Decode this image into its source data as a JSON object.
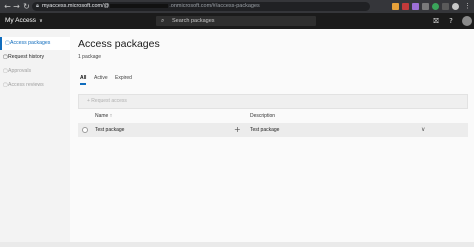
{
  "browser": {
    "back_icon": "←",
    "forward_icon": "→",
    "reload_icon": "↻",
    "url_host": "myaccess.microsoft.com",
    "url_mid": "/@",
    "url_path": ".onmicrosoft.com/#/access-packages"
  },
  "app": {
    "brand": "My Access",
    "brand_chevron": "∨",
    "search_placeholder": "Search packages",
    "search_icon": "⌕",
    "org_icon": "⛝",
    "help_icon": "?",
    "settings_icon": "⚙"
  },
  "sidebar": {
    "items": [
      {
        "label": "Access packages",
        "icon": "▢"
      },
      {
        "label": "Request history",
        "icon": "▢"
      },
      {
        "label": "Approvals",
        "icon": "▢"
      },
      {
        "label": "Access reviews",
        "icon": "▢"
      }
    ]
  },
  "main": {
    "title": "Access packages",
    "count": "1 package",
    "tabs": [
      "All",
      "Active",
      "Expired"
    ],
    "request_label": "+ Request access",
    "columns": [
      "Name ↑",
      "Description"
    ],
    "rows": [
      {
        "name": "Test package",
        "plus": "+",
        "description": "Test package",
        "expand": "∨"
      }
    ]
  },
  "colors": {
    "accent": "#0f6cbd",
    "appbar": "#1b1b1b"
  }
}
